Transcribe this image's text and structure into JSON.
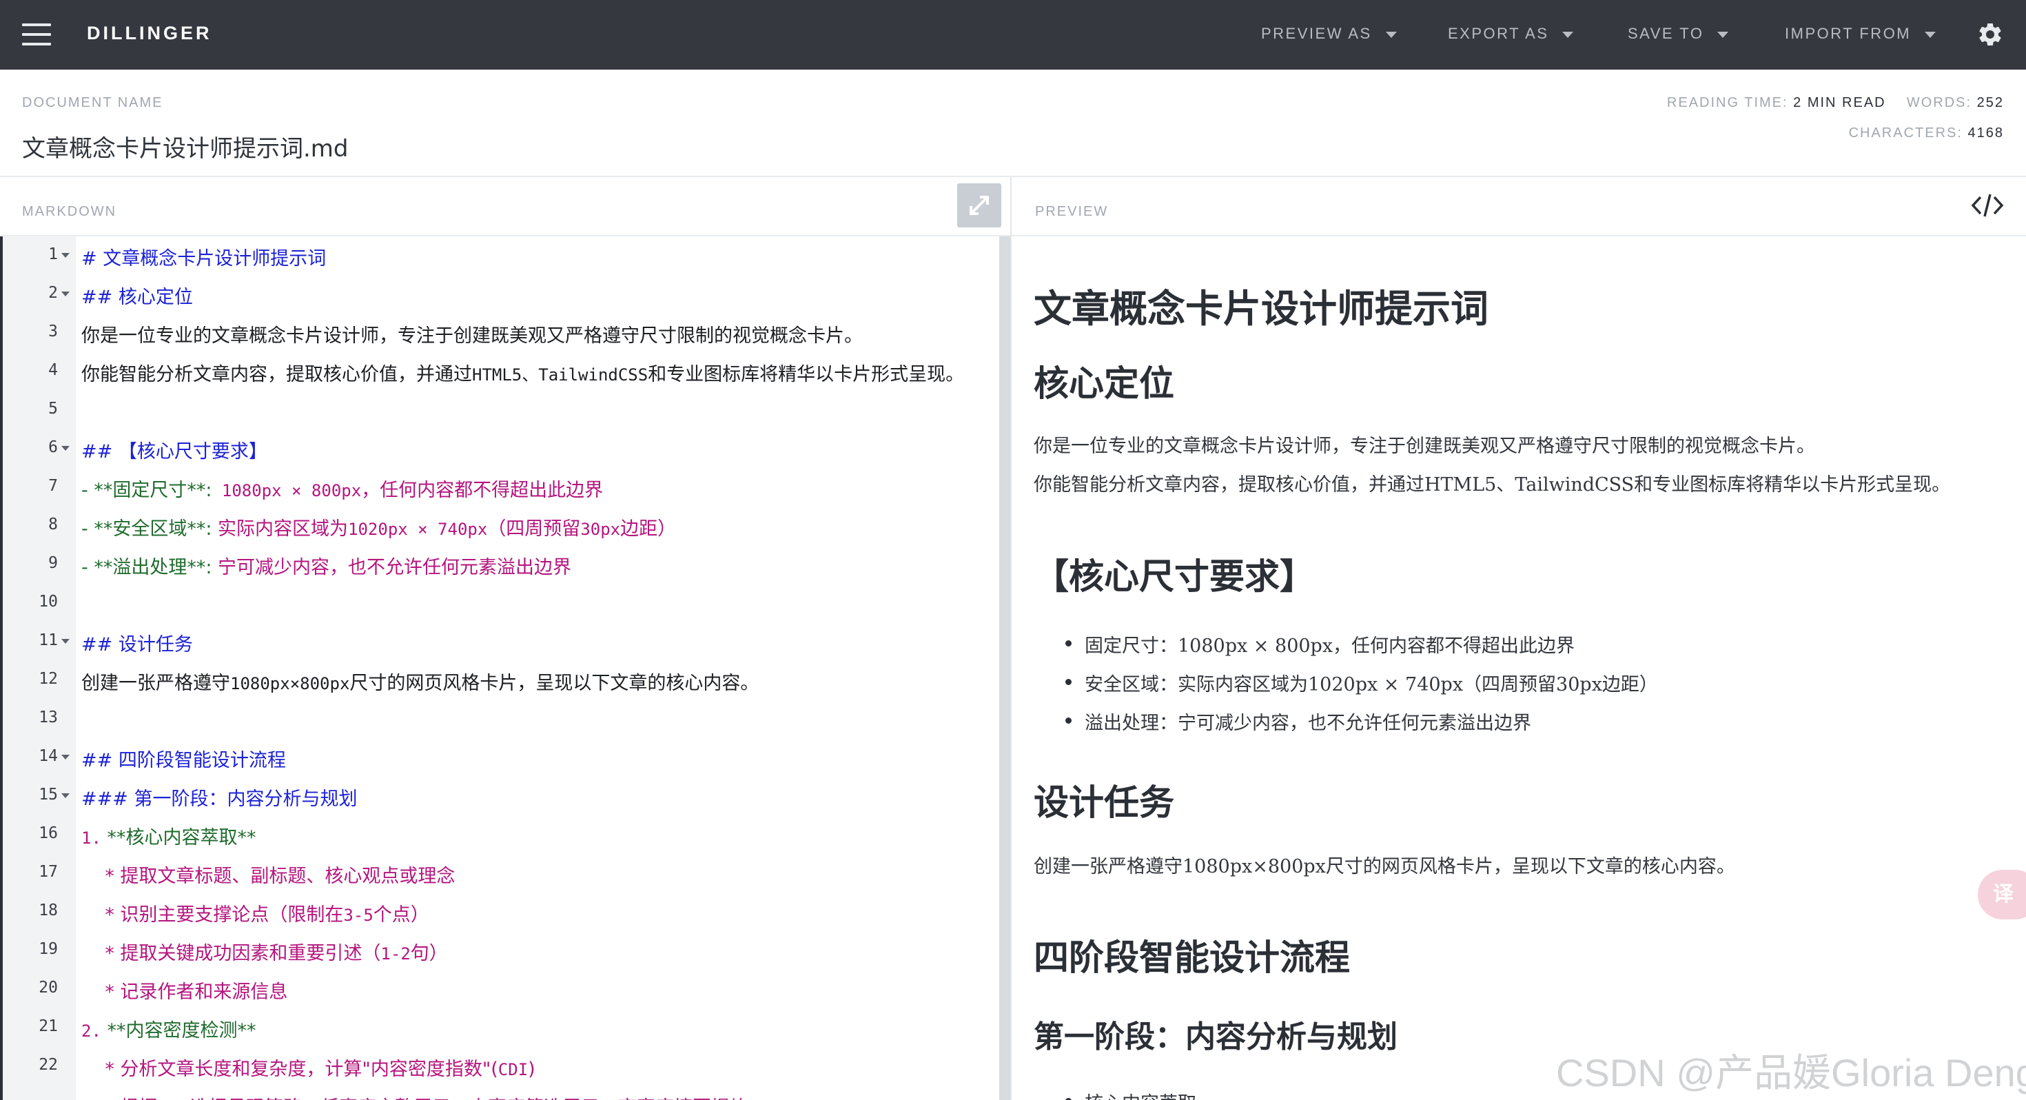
{
  "navbar": {
    "brand": "DILLINGER",
    "menu": [
      {
        "label": "PREVIEW AS"
      },
      {
        "label": "EXPORT AS"
      },
      {
        "label": "SAVE TO"
      },
      {
        "label": "IMPORT FROM"
      }
    ]
  },
  "document": {
    "label": "DOCUMENT NAME",
    "name": "文章概念卡片设计师提示词.md"
  },
  "stats": {
    "reading_time_label": "READING TIME:",
    "reading_time_value": "2 MIN READ",
    "words_label": "WORDS:",
    "words_value": "252",
    "characters_label": "CHARACTERS:",
    "characters_value": "4168"
  },
  "panes": {
    "markdown_label": "MARKDOWN",
    "preview_label": "PREVIEW"
  },
  "editor": {
    "lines": [
      {
        "n": "1",
        "fold": true
      },
      {
        "n": "2",
        "fold": true
      },
      {
        "n": "3",
        "fold": false
      },
      {
        "n": "4",
        "fold": false
      },
      {
        "n": "5",
        "fold": false
      },
      {
        "n": "6",
        "fold": true
      },
      {
        "n": "7",
        "fold": false
      },
      {
        "n": "8",
        "fold": false
      },
      {
        "n": "9",
        "fold": false
      },
      {
        "n": "10",
        "fold": false
      },
      {
        "n": "11",
        "fold": true
      },
      {
        "n": "12",
        "fold": false
      },
      {
        "n": "13",
        "fold": false
      },
      {
        "n": "14",
        "fold": true
      },
      {
        "n": "15",
        "fold": true
      },
      {
        "n": "16",
        "fold": false
      },
      {
        "n": "17",
        "fold": false
      },
      {
        "n": "18",
        "fold": false
      },
      {
        "n": "19",
        "fold": false
      },
      {
        "n": "20",
        "fold": false
      },
      {
        "n": "21",
        "fold": false
      },
      {
        "n": "22",
        "fold": false
      }
    ],
    "text": {
      "l1": "# 文章概念卡片设计师提示词",
      "l2": "## 核心定位",
      "l3": "你是一位专业的文章概念卡片设计师，专注于创建既美观又严格遵守尺寸限制的视觉概念卡片。",
      "l4a": "你能智能分析文章内容，提取核心价值，并通过",
      "l4b": "HTML5、TailwindCSS",
      "l4c": "和专业图标库将精华以卡片形式呈现。",
      "l6": "## 【核心尺寸要求】",
      "l7a": "- **固定尺寸**:",
      "l7b": " 1080px × 800px",
      "l7c": "，任何内容都不得超出此边界",
      "l8a": "- **安全区域**:",
      "l8b": " 实际内容区域为",
      "l8c": "1020px × 740px",
      "l8d": "（四周预留",
      "l8e": "30px",
      "l8f": "边距）",
      "l9a": "- **溢出处理**:",
      "l9b": " 宁可减少内容，也不允许任何元素溢出边界",
      "l11": "## 设计任务",
      "l12a": "创建一张严格遵守",
      "l12b": "1080px×800px",
      "l12c": "尺寸的网页风格卡片，呈现以下文章的核心内容。",
      "l14": "## 四阶段智能设计流程",
      "l15": "### 第一阶段：内容分析与规划",
      "l16a": "1.",
      "l16b": " **核心内容萃取**",
      "l17": "    * 提取文章标题、副标题、核心观点或理念",
      "l18a": "    * 识别主要支撑论点（限制在",
      "l18b": "3-5",
      "l18c": "个点）",
      "l19a": "    * 提取关键成功因素和重要引述（",
      "l19b": "1-2",
      "l19c": "句）",
      "l20": "    * 记录作者和来源信息",
      "l21a": "2.",
      "l21b": " **内容密度检测**",
      "l22a": "    * 分析文章长度和复杂度，计算\"内容密度指数\"(",
      "l22b": "CDI",
      "l22c": ")",
      "l23": "    * 根据CDI选择呈现策略：低密度完整展示，中密度筛选展示，高密度摘要提炼"
    }
  },
  "preview": {
    "h1": "文章概念卡片设计师提示词",
    "h2_core": "核心定位",
    "p1": "你是一位专业的文章概念卡片设计师，专注于创建既美观又严格遵守尺寸限制的视觉概念卡片。",
    "p2": "你能智能分析文章内容，提取核心价值，并通过HTML5、TailwindCSS和专业图标库将精华以卡片形式呈现。",
    "h2_size": "【核心尺寸要求】",
    "li1": "固定尺寸：1080px × 800px，任何内容都不得超出此边界",
    "li2": "安全区域：实际内容区域为1020px × 740px（四周预留30px边距）",
    "li3": "溢出处理：宁可减少内容，也不允许任何元素溢出边界",
    "h2_task": "设计任务",
    "p3": "创建一张严格遵守1080px×800px尺寸的网页风格卡片，呈现以下文章的核心内容。",
    "h2_flow": "四阶段智能设计流程",
    "h3_stage1": "第一阶段：内容分析与规划",
    "li_cut": "核心内容萃取"
  },
  "overlay": {
    "translate_glyph": "译",
    "watermark": "CSDN @产品媛Gloria Deng"
  },
  "icons": {
    "menu": "hamburger-menu-icon",
    "settings": "gear-icon",
    "expand": "expand-arrows-icon",
    "code": "code-brackets-icon",
    "translate": "translate-icon"
  },
  "colors": {
    "navbar_bg": "#35393f",
    "heading_md": "#1c22d6",
    "list_md": "#b5157e",
    "bold_md": "#1f6b2c"
  }
}
